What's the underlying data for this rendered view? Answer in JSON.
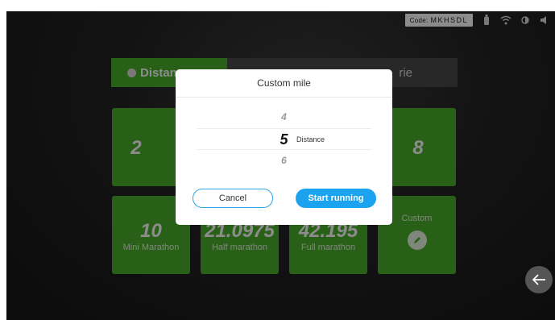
{
  "status": {
    "code_label": "Code:",
    "code_value": "MKHSDL"
  },
  "tabs": {
    "active": "Distan",
    "inactive": "rie"
  },
  "cards": [
    {
      "num": "2",
      "label": ""
    },
    {
      "num": "8",
      "label": ""
    },
    {
      "num": "10",
      "label": "Mini Marathon"
    },
    {
      "num": "21.0975",
      "label": "Half marathon"
    },
    {
      "num": "42.195",
      "label": "Full marathon"
    },
    {
      "num": "",
      "label": "Custom"
    }
  ],
  "dialog": {
    "title": "Custom mile",
    "picker": {
      "prev": "4",
      "selected": "5",
      "next": "6",
      "unit": "Distance"
    },
    "cancel_label": "Cancel",
    "start_label": "Start running"
  }
}
